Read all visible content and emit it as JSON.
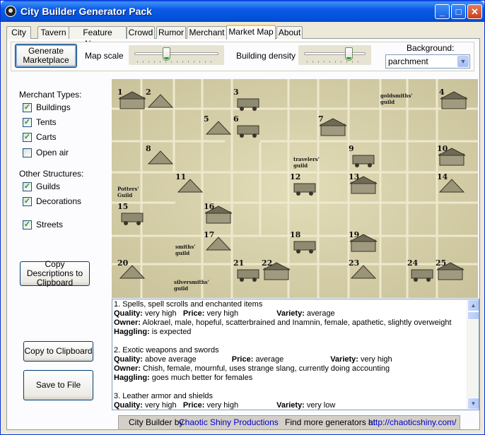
{
  "window": {
    "title": "City Builder Generator Pack",
    "minimize": "_",
    "maximize": "□",
    "close": "✕"
  },
  "tabs": [
    {
      "label": "City"
    },
    {
      "label": "Tavern"
    },
    {
      "label": "Feature Namer"
    },
    {
      "label": "Crowd"
    },
    {
      "label": "Rumor"
    },
    {
      "label": "Merchant"
    },
    {
      "label": "Market Map",
      "active": true
    },
    {
      "label": "About"
    }
  ],
  "toolbar": {
    "generate_label": "Generate Marketplace",
    "map_scale_label": "Map scale",
    "map_scale_value": 0.38,
    "building_density_label": "Building density",
    "building_density_value": 0.72,
    "background_label": "Background:",
    "background_value": "parchment"
  },
  "options": {
    "merchant_types_label": "Merchant Types:",
    "merchant_types": [
      {
        "label": "Buildings",
        "checked": true
      },
      {
        "label": "Tents",
        "checked": true
      },
      {
        "label": "Carts",
        "checked": true
      },
      {
        "label": "Open air",
        "checked": false
      }
    ],
    "other_structures_label": "Other Structures:",
    "other_structures": [
      {
        "label": "Guilds",
        "checked": true
      },
      {
        "label": "Decorations",
        "checked": true
      }
    ],
    "streets": {
      "label": "Streets",
      "checked": true
    }
  },
  "buttons": {
    "copy_descriptions": "Copy Descriptions to Clipboard",
    "copy_clipboard": "Copy to Clipboard",
    "save_file": "Save to File"
  },
  "map": {
    "numbers": [
      "1",
      "2",
      "3",
      "4",
      "5",
      "6",
      "7",
      "8",
      "9",
      "10",
      "11",
      "12",
      "13",
      "14",
      "15",
      "16",
      "17",
      "18",
      "19",
      "20",
      "21",
      "22",
      "23",
      "24",
      "25"
    ],
    "guild_labels": [
      "goldsmiths' guild",
      "travelers' guild",
      "Potters' Guild",
      "smiths' guild",
      "silversmiths' guild"
    ],
    "guild_lines": [
      [
        "goldsmiths'",
        "guild"
      ],
      [
        "travelers'",
        "guild"
      ],
      [
        "Potters'",
        "Guild"
      ],
      [
        "smiths'",
        "guild"
      ],
      [
        "silversmiths'",
        "guild"
      ]
    ]
  },
  "description": {
    "field_labels": {
      "quality": "Quality:",
      "price": "Price:",
      "variety": "Variety:",
      "owner": "Owner:",
      "haggling": "Haggling:"
    },
    "entries": [
      {
        "title": "1. Spells, spell scrolls and enchanted items",
        "quality": "very high",
        "price": "very high",
        "variety": "average",
        "owner": "Alokrael, male, hopeful, scatterbrained and Inamnin, female, apathetic, slightly overweight",
        "haggling": "is expected"
      },
      {
        "title": "2. Exotic weapons and swords",
        "quality": "above average",
        "price": "average",
        "variety": "very high",
        "owner": "Chish, female, mournful, uses strange slang, currently doing accounting",
        "haggling": "goes much better for females"
      },
      {
        "title": "3. Leather armor and shields",
        "quality": "very high",
        "price": "very high",
        "variety": "very low"
      }
    ]
  },
  "footer": {
    "prefix": "City Builder by",
    "author": "Chaotic Shiny Productions",
    "find_more": "Find more generators at",
    "url": "http://chaoticshiny.com/"
  }
}
